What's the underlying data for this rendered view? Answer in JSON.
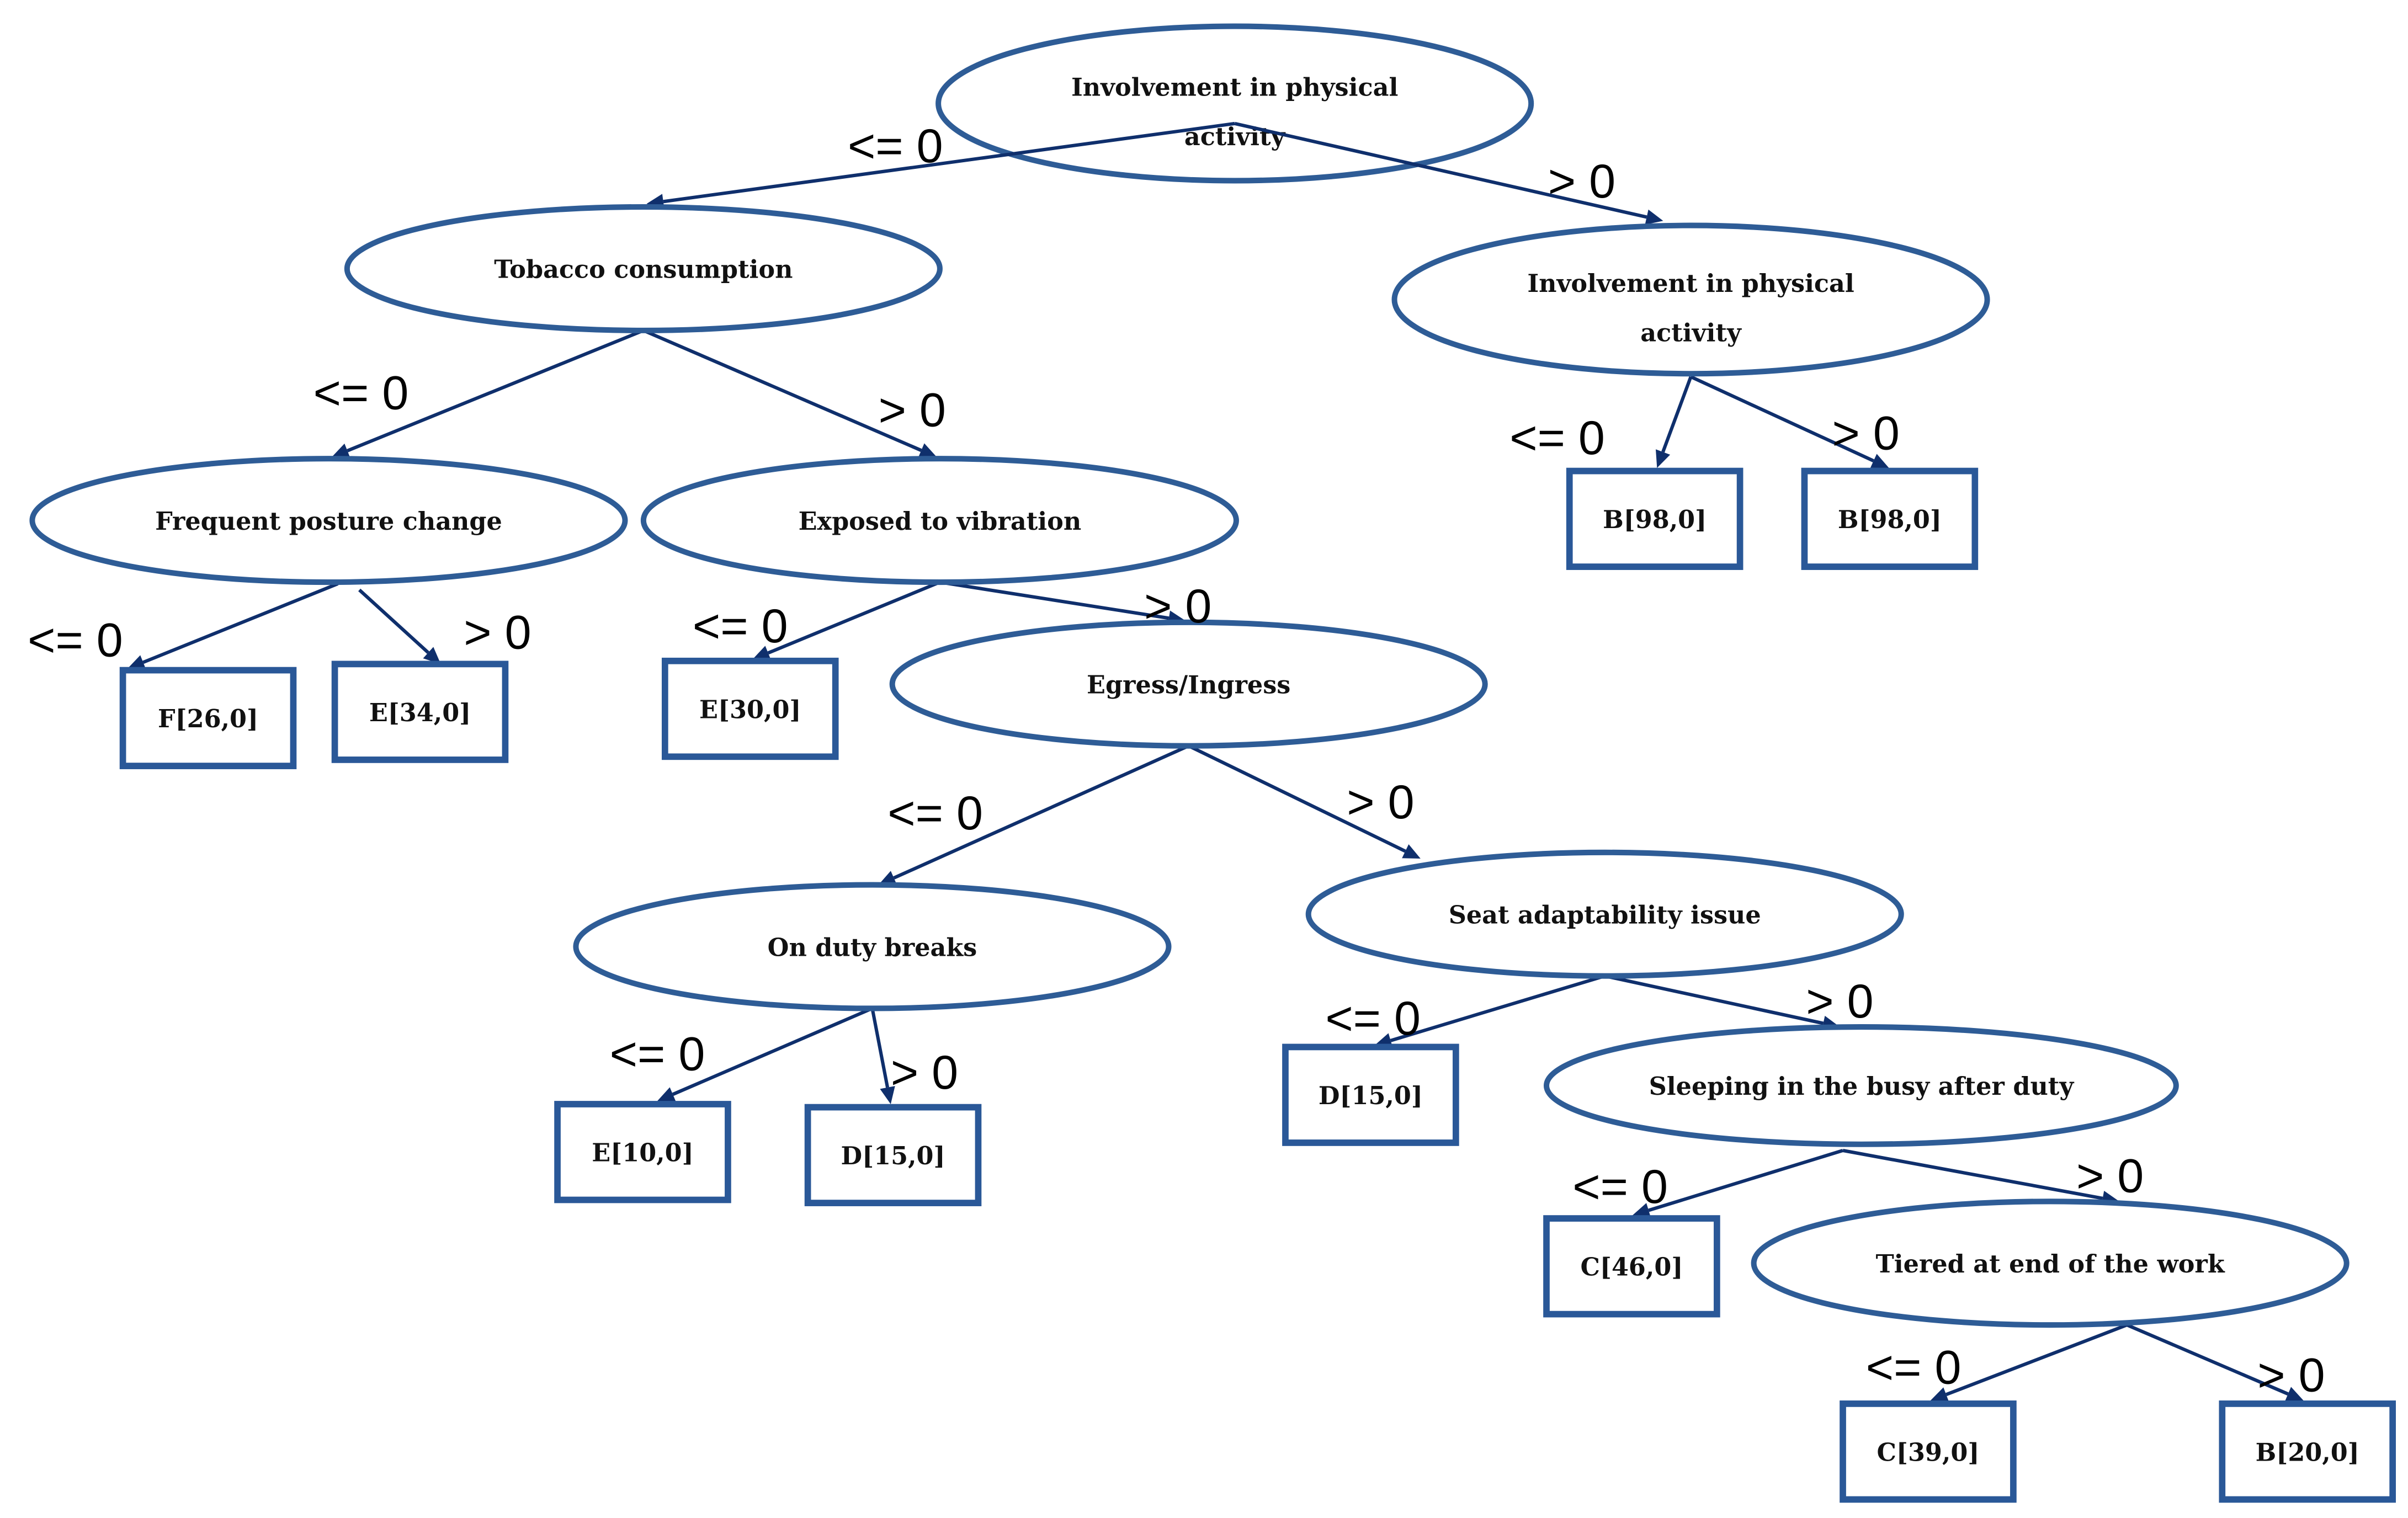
{
  "diagram": {
    "type": "decision-tree",
    "colors": {
      "node_stroke": "#2e5c96",
      "edge": "#0f2f6c",
      "leaf_stroke": "#2a5898"
    },
    "nodes": [
      {
        "id": "n1",
        "kind": "decision",
        "lines": [
          "Involvement in physical",
          "activity"
        ]
      },
      {
        "id": "n2",
        "kind": "decision",
        "lines": [
          "Tobacco consumption"
        ]
      },
      {
        "id": "n3",
        "kind": "decision",
        "lines": [
          "Involvement in physical",
          "activity"
        ]
      },
      {
        "id": "n4",
        "kind": "decision",
        "lines": [
          "Frequent posture change"
        ]
      },
      {
        "id": "n5",
        "kind": "decision",
        "lines": [
          "Exposed to vibration"
        ]
      },
      {
        "id": "n6",
        "kind": "decision",
        "lines": [
          "Egress/Ingress"
        ]
      },
      {
        "id": "n7",
        "kind": "decision",
        "lines": [
          "On duty breaks"
        ]
      },
      {
        "id": "n8",
        "kind": "decision",
        "lines": [
          "Seat adaptability issue"
        ]
      },
      {
        "id": "n9",
        "kind": "decision",
        "lines": [
          "Sleeping in the busy after duty"
        ]
      },
      {
        "id": "n10",
        "kind": "decision",
        "lines": [
          "Tiered at end of the work"
        ]
      },
      {
        "id": "l1",
        "kind": "leaf",
        "label": "B[98,0]"
      },
      {
        "id": "l2",
        "kind": "leaf",
        "label": "B[98,0]"
      },
      {
        "id": "l3",
        "kind": "leaf",
        "label": "F[26,0]"
      },
      {
        "id": "l4",
        "kind": "leaf",
        "label": "E[34,0]"
      },
      {
        "id": "l5",
        "kind": "leaf",
        "label": "E[30,0]"
      },
      {
        "id": "l6",
        "kind": "leaf",
        "label": "E[10,0]"
      },
      {
        "id": "l7",
        "kind": "leaf",
        "label": "D[15,0]"
      },
      {
        "id": "l8",
        "kind": "leaf",
        "label": "D[15,0]"
      },
      {
        "id": "l9",
        "kind": "leaf",
        "label": "C[46,0]"
      },
      {
        "id": "l10",
        "kind": "leaf",
        "label": "C[39,0]"
      },
      {
        "id": "l11",
        "kind": "leaf",
        "label": "B[20,0]"
      }
    ],
    "edges": [
      {
        "from": "n1",
        "to": "n2",
        "label": "<= 0"
      },
      {
        "from": "n1",
        "to": "n3",
        "label": "> 0"
      },
      {
        "from": "n3",
        "to": "l1",
        "label": "<= 0"
      },
      {
        "from": "n3",
        "to": "l2",
        "label": "> 0"
      },
      {
        "from": "n2",
        "to": "n4",
        "label": "<= 0"
      },
      {
        "from": "n2",
        "to": "n5",
        "label": "> 0"
      },
      {
        "from": "n4",
        "to": "l3",
        "label": "<= 0"
      },
      {
        "from": "n4",
        "to": "l4",
        "label": "> 0"
      },
      {
        "from": "n5",
        "to": "l5",
        "label": "<= 0"
      },
      {
        "from": "n5",
        "to": "n6",
        "label": "> 0"
      },
      {
        "from": "n6",
        "to": "n7",
        "label": "<= 0"
      },
      {
        "from": "n6",
        "to": "n8",
        "label": "> 0"
      },
      {
        "from": "n7",
        "to": "l6",
        "label": "<= 0"
      },
      {
        "from": "n7",
        "to": "l7",
        "label": "> 0"
      },
      {
        "from": "n8",
        "to": "l8",
        "label": "<= 0"
      },
      {
        "from": "n8",
        "to": "n9",
        "label": "> 0"
      },
      {
        "from": "n9",
        "to": "l9",
        "label": "<= 0"
      },
      {
        "from": "n9",
        "to": "n10",
        "label": "> 0"
      },
      {
        "from": "n10",
        "to": "l10",
        "label": "<= 0"
      },
      {
        "from": "n10",
        "to": "l11",
        "label": "> 0"
      }
    ]
  }
}
